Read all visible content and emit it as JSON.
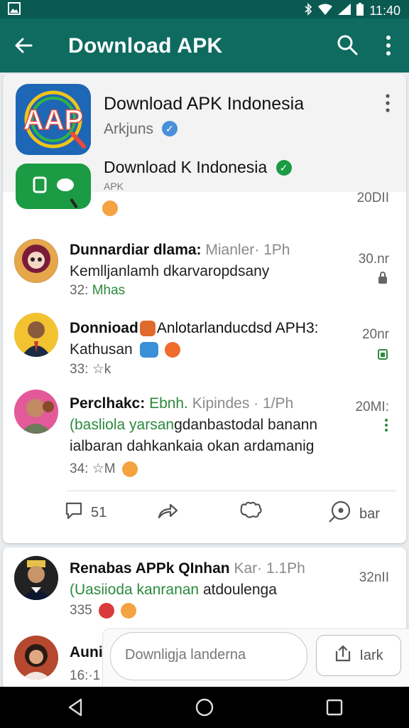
{
  "status_bar": {
    "time": "11:40"
  },
  "app_bar": {
    "title": "Download APK"
  },
  "header": {
    "title1": "Download APK Indonesia",
    "sub1": "Arkjuns",
    "title2": "Download K Indonesia",
    "sub2": "APK",
    "partial_time": "20DII"
  },
  "rows": [
    {
      "title_bold": "Dunnardiar dlama:",
      "title_muted": " Mianler· 1Ph",
      "line1": "Kemlljanlamh dkarvaropdsany",
      "meta_prefix": "32:",
      "meta_green": " Mhas",
      "time": "30.nr"
    },
    {
      "title_bold": "Donnioad",
      "title_rest": "Anlotarlanducdsd APH3:",
      "line1": "Kathusan",
      "meta_prefix": "33:",
      "meta_rest": "k",
      "time": "20nr"
    },
    {
      "title_bold": "Perclhakc:",
      "title_green": " Ebnh.",
      "title_muted": " Kipindes · 1/Ph",
      "line1_green": "(basliola yarsan",
      "line1_rest": "gdanbastodal banann",
      "line2": "ialbaran dahkankaia okan ardamanig",
      "meta_prefix": "34:",
      "meta_rest": "M",
      "time": "20MI:"
    }
  ],
  "actions": [
    {
      "label": "51",
      "icon": "comment-icon"
    },
    {
      "label": "",
      "icon": "share-icon"
    },
    {
      "label": "",
      "icon": "puzzle-icon"
    },
    {
      "label": "bar",
      "icon": "location-icon"
    }
  ],
  "row4": {
    "title_bold": "Renabas APPk QInhan",
    "title_muted": " Kar· 1.1Ph",
    "line1_green": "(Uasiioda kanranan",
    "line1_rest": " atdoulenga",
    "meta_prefix": "335",
    "time": "32nII"
  },
  "row5": {
    "title_bold": "Auni",
    "meta_prefix": "16:·1"
  },
  "composer": {
    "placeholder": "Downligja landerna",
    "button_label": "Iark"
  },
  "colors": {
    "primary": "#0f6b60",
    "status_bar": "#0a5a52",
    "accent_green": "#2b8a3e",
    "verified_blue": "#4a90d9"
  }
}
